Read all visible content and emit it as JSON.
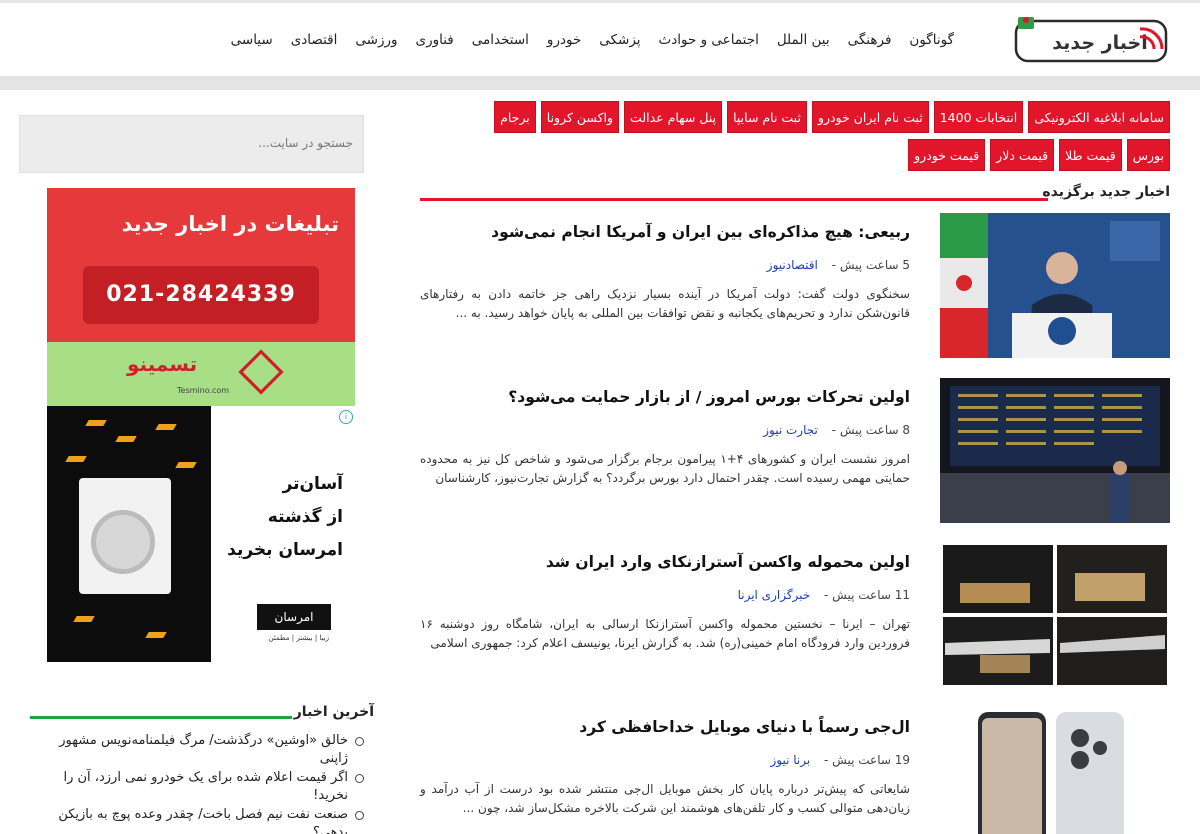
{
  "header": {
    "logo_text": "اخبار جدید",
    "nav": [
      "سیاسی",
      "اقتصادی",
      "ورزشی",
      "فناوری",
      "استخدامی",
      "خودرو",
      "پزشکی",
      "اجتماعی و حوادث",
      "بین الملل",
      "فرهنگی",
      "گوناگون"
    ]
  },
  "tags": [
    "سامانه ابلاغیه الکترونیکی",
    "انتخابات 1400",
    "ثبت نام ایران خودرو",
    "ثبت نام سایپا",
    "پنل سهام عدالت",
    "واکسن کرونا",
    "برجام",
    "بورس",
    "قیمت طلا",
    "قیمت دلار",
    "قیمت خودرو"
  ],
  "featured": {
    "title": "اخبار جدید برگزیده",
    "accent": "#e1162b",
    "articles": [
      {
        "title": "ربیعی: هیچ مذاکره‌ای بین ایران و آمریکا انجام نمی‌شود",
        "time": "5 ساعت پیش -",
        "source": "اقتصادنیوز",
        "excerpt": "سخنگوی دولت گفت: دولت آمریکا در آینده بسیار نزدیک راهی جز خاتمه دادن به رفتارهای قانون‌شکن ندارد و تحریم‌های یکجانبه و نقض توافقات بین المللی به پایان خواهد رسید. به ..."
      },
      {
        "title": "اولین تحرکات بورس امروز / از بازار حمایت می‌شود؟",
        "time": "8 ساعت پیش -",
        "source": "تجارت نیوز",
        "excerpt": "امروز نشست ایران و کشورهای ۴+۱ پیرامون برجام برگزار می‌شود و شاخص کل نیز به محدوده حمایتی مهمی رسیده است. چقدر احتمال دارد بورس برگردد؟ به گزارش تجارت‌نیوز، کارشناسان"
      },
      {
        "title": "اولین محموله واکسن آسترازنکای وارد ایران شد",
        "time": "11 ساعت پیش -",
        "source": "خبرگزاری ایرنا",
        "excerpt": "تهران – ایرنا – نخستین محموله واکسن آسترازنکا ارسالی به ایران، شامگاه روز دوشنبه ۱۶ فروردین وارد فرودگاه امام خمینی(ره) شد. به گزارش ایرنا، یونیسف اعلام کرد: جمهوری اسلامی"
      },
      {
        "title": "ال‌جی رسماً با دنیای موبایل خداحافظی کرد",
        "time": "19 ساعت پیش -",
        "source": "برنا نیوز",
        "excerpt": "شایعاتی که پیش‌تر درباره پایان کار بخش موبایل ال‌جی منتشر شده بود درست از آب درآمد و زیان‌دهی متوالی کسب و کار تلفن‌های هوشمند این شرکت بالاخره مشکل‌ساز شد، چون ..."
      }
    ]
  },
  "sidebar": {
    "search_placeholder": "جستجو در سایت...",
    "ad": {
      "title": "تبلیغات در اخبار جدید",
      "phone": "021-28424339",
      "brand": "تسمینو",
      "brand_url": "Tesmino.com",
      "slogan_lines": [
        "آسان‌تر",
        "از گذشته",
        "امرسان بخرید"
      ],
      "brand2": "امرسان",
      "brand2_sub": "زیبا | بیشتر | مطمئن"
    },
    "latest_title": "آخرین اخبار",
    "latest_accent": "#1fa33f",
    "latest": [
      "خالق «اوشین» درگذشت/ مرگ فیلمنامه‌نویس مشهور ژاپنی",
      "اگر قیمت اعلام شده برای یک خودرو نمی ارزد، آن را نخرید!",
      "صنعت نفت نیم فصل باخت/ چقدر وعده پوچ به بازیکن بدهی؟"
    ]
  }
}
